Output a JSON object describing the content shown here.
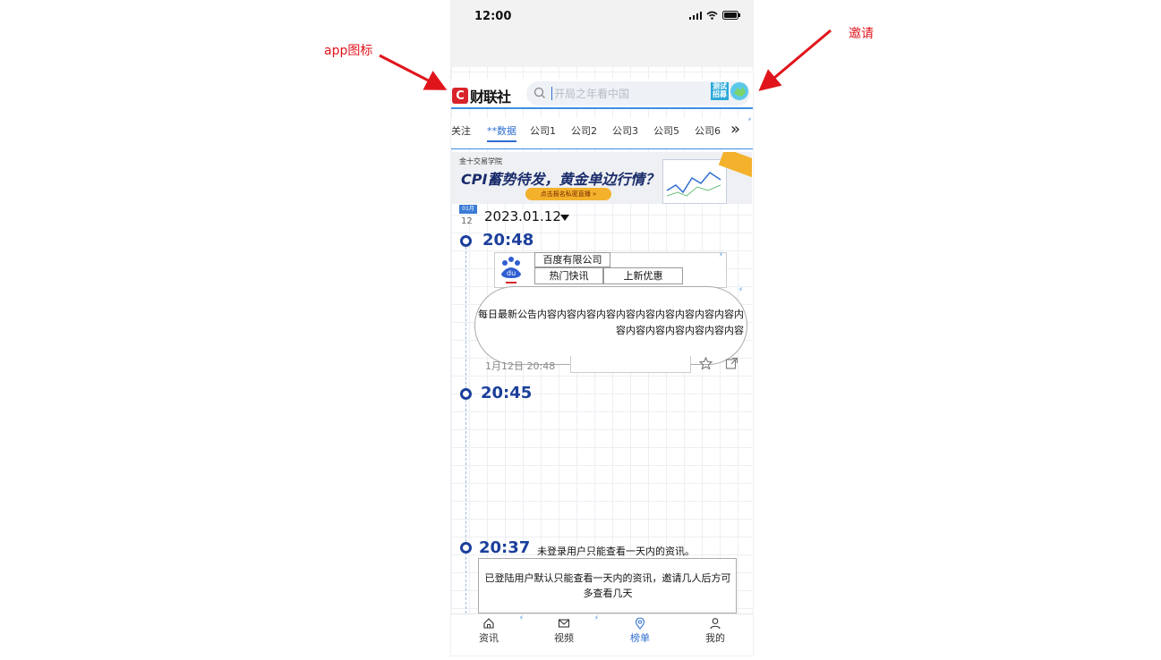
{
  "annotations": {
    "app_icon_label": "app图标",
    "invite_label": "邀请",
    "color": "#e0151b"
  },
  "status_bar": {
    "time": "12:00"
  },
  "header": {
    "logo_letter": "C",
    "logo_text": "财联社",
    "search_placeholder": "开局之年看中国",
    "invite_badge": "测试招募"
  },
  "tabs": [
    {
      "label": "关注"
    },
    {
      "label": "**数据"
    },
    {
      "label": "公司1"
    },
    {
      "label": "公司2"
    },
    {
      "label": "公司3"
    },
    {
      "label": "公司5"
    },
    {
      "label": "公司6"
    }
  ],
  "banner": {
    "brand": "金十交易学院",
    "title": "CPI蓄势待发，黄金单边行情？",
    "button": "点击报名私密直播 »"
  },
  "date_header": {
    "badge": "01月",
    "day": "12",
    "date": "2023.01.12"
  },
  "entries": [
    {
      "time": "20:48",
      "company": "百度有限公司",
      "tags": [
        "热门快讯",
        "上新优惠"
      ],
      "content": "每日最新公告内容内容内容内容内容内容内容内容内容内容内容内容内容内容内容内容内容",
      "meta": "1月12日 20:48"
    },
    {
      "time": "20:45"
    },
    {
      "time": "20:37",
      "notice": "未登录用户只能查看一天内的资讯。",
      "notice_box": "已登陆用户默认只能查看一天内的资讯，邀请几人后方可多查看几天"
    }
  ],
  "bottom_nav": [
    {
      "label": "资讯",
      "icon": "home-icon"
    },
    {
      "label": "视频",
      "icon": "mail-icon"
    },
    {
      "label": "榜单",
      "icon": "location-pin-icon"
    },
    {
      "label": "我的",
      "icon": "user-icon"
    }
  ],
  "colors": {
    "accent": "#2f6fd1",
    "brand_red": "#d8232a",
    "timeline": "#1b3f9b"
  }
}
